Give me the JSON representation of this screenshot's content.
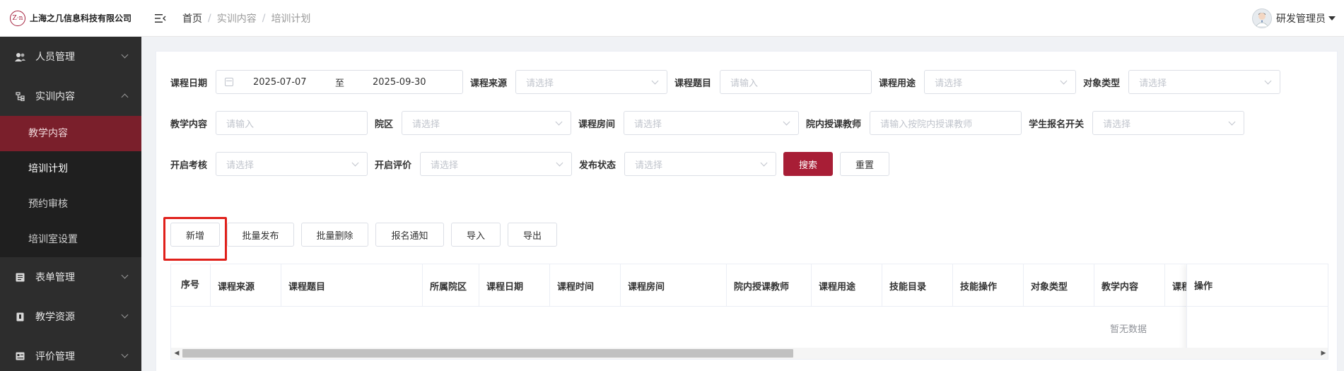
{
  "app": {
    "logo_mark": "Z·n",
    "company": "上海之几信息科技有限公司"
  },
  "breadcrumb": {
    "home": "首页",
    "section": "实训内容",
    "page": "培训计划",
    "separator": "/"
  },
  "user": {
    "name": "研发管理员"
  },
  "sidebar": {
    "groups": [
      {
        "label": "人员管理",
        "icon": "user-group-icon"
      },
      {
        "label": "实训内容",
        "icon": "tree-icon"
      },
      {
        "label": "表单管理",
        "icon": "form-icon"
      },
      {
        "label": "教学资源",
        "icon": "book-icon"
      },
      {
        "label": "评价管理",
        "icon": "rating-icon"
      }
    ],
    "sub_items": [
      {
        "label": "教学内容"
      },
      {
        "label": "培训计划"
      },
      {
        "label": "预约审核"
      },
      {
        "label": "培训室设置"
      }
    ]
  },
  "filters": {
    "course_date": {
      "label": "课程日期",
      "start": "2025-07-07",
      "to": "至",
      "end": "2025-09-30"
    },
    "course_source": {
      "label": "课程来源",
      "placeholder": "请选择"
    },
    "course_topic": {
      "label": "课程题目",
      "placeholder": "请输入"
    },
    "course_purpose": {
      "label": "课程用途",
      "placeholder": "请选择"
    },
    "target_type": {
      "label": "对象类型",
      "placeholder": "请选择"
    },
    "teaching_content": {
      "label": "教学内容",
      "placeholder": "请输入"
    },
    "campus": {
      "label": "院区",
      "placeholder": "请选择"
    },
    "course_room": {
      "label": "课程房间",
      "placeholder": "请选择"
    },
    "instructor": {
      "label": "院内授课教师",
      "placeholder": "请输入按院内授课教师"
    },
    "student_signup": {
      "label": "学生报名开关",
      "placeholder": "请选择"
    },
    "assessment": {
      "label": "开启考核",
      "placeholder": "请选择"
    },
    "evaluation": {
      "label": "开启评价",
      "placeholder": "请选择"
    },
    "publish_status": {
      "label": "发布状态",
      "placeholder": "请选择"
    },
    "search_button": "搜索",
    "reset_button": "重置"
  },
  "toolbar": {
    "add": "新增",
    "batch_publish": "批量发布",
    "batch_delete": "批量删除",
    "signup_notice": "报名通知",
    "import": "导入",
    "export": "导出"
  },
  "table": {
    "columns": [
      "序号",
      "课程来源",
      "课程题目",
      "所属院区",
      "课程日期",
      "课程时间",
      "课程房间",
      "院内授课教师",
      "课程用途",
      "技能目录",
      "技能操作",
      "对象类型",
      "教学内容",
      "课程"
    ],
    "fixed_column": "操作",
    "empty_text": "暂无数据",
    "rows": []
  },
  "colors": {
    "sidebar_bg": "#2d2d2d",
    "active_item": "#7a1f2b",
    "primary": "#a81e36",
    "highlight": "#e0201b"
  }
}
